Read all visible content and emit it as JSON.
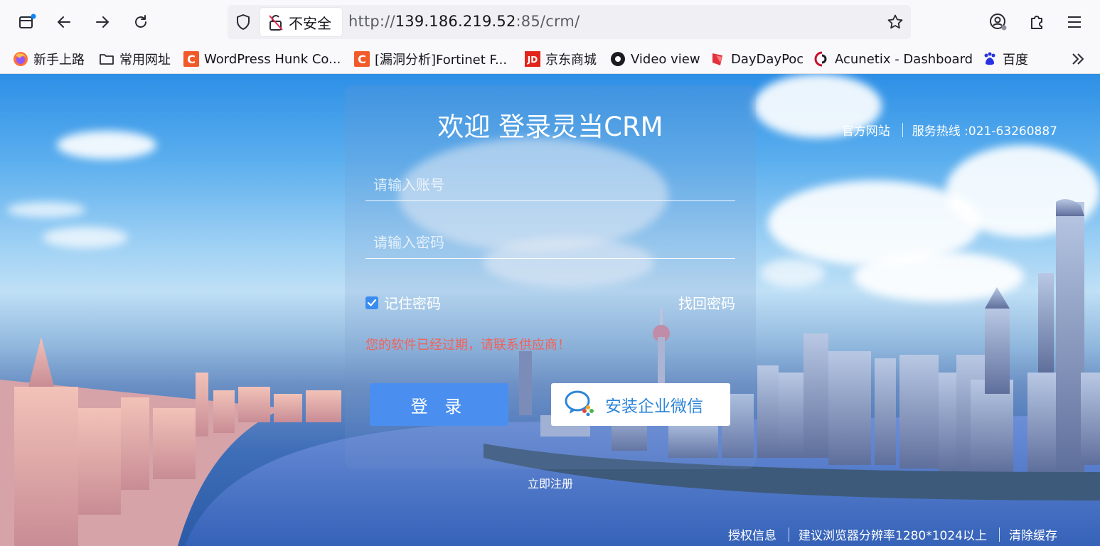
{
  "browser": {
    "not_secure_label": "不安全",
    "url_scheme": "http://",
    "url_host": "139.186.219.52",
    "url_rest": ":85/crm/",
    "bookmarks": [
      {
        "label": "新手上路",
        "icon": "firefox-icon"
      },
      {
        "label": "常用网址",
        "icon": "folder-icon"
      },
      {
        "label": "WordPress Hunk Co...",
        "icon": "c-logo-icon"
      },
      {
        "label": "[漏洞分析]Fortinet F...",
        "icon": "c-logo-icon"
      },
      {
        "label": "京东商城",
        "icon": "jd-icon"
      },
      {
        "label": "Video view",
        "icon": "video-icon"
      },
      {
        "label": "DayDayPoc",
        "icon": "daydaypoc-icon"
      },
      {
        "label": "Acunetix - Dashboard",
        "icon": "acunetix-icon"
      },
      {
        "label": "百度",
        "icon": "baidu-icon"
      }
    ]
  },
  "login": {
    "title": "欢迎 登录灵当CRM",
    "username_placeholder": "请输入账号",
    "password_placeholder": "请输入密码",
    "remember_label": "记住密码",
    "remember_checked": true,
    "forgot_label": "找回密码",
    "error_message": "您的软件已经过期，请联系供应商！",
    "login_button": "登 录",
    "wechat_button": "安装企业微信",
    "register_link": "立即注册"
  },
  "header_links": {
    "official_site": "官方网站",
    "hotline": "服务热线 :021-63260887"
  },
  "footer_links": {
    "license": "授权信息",
    "resolution": "建议浏览器分辨率1280*1024以上",
    "clear_cache": "清除缓存"
  },
  "colors": {
    "accent": "#4a8ff0",
    "error": "#f0625a",
    "wechat": "#2f86d8"
  }
}
